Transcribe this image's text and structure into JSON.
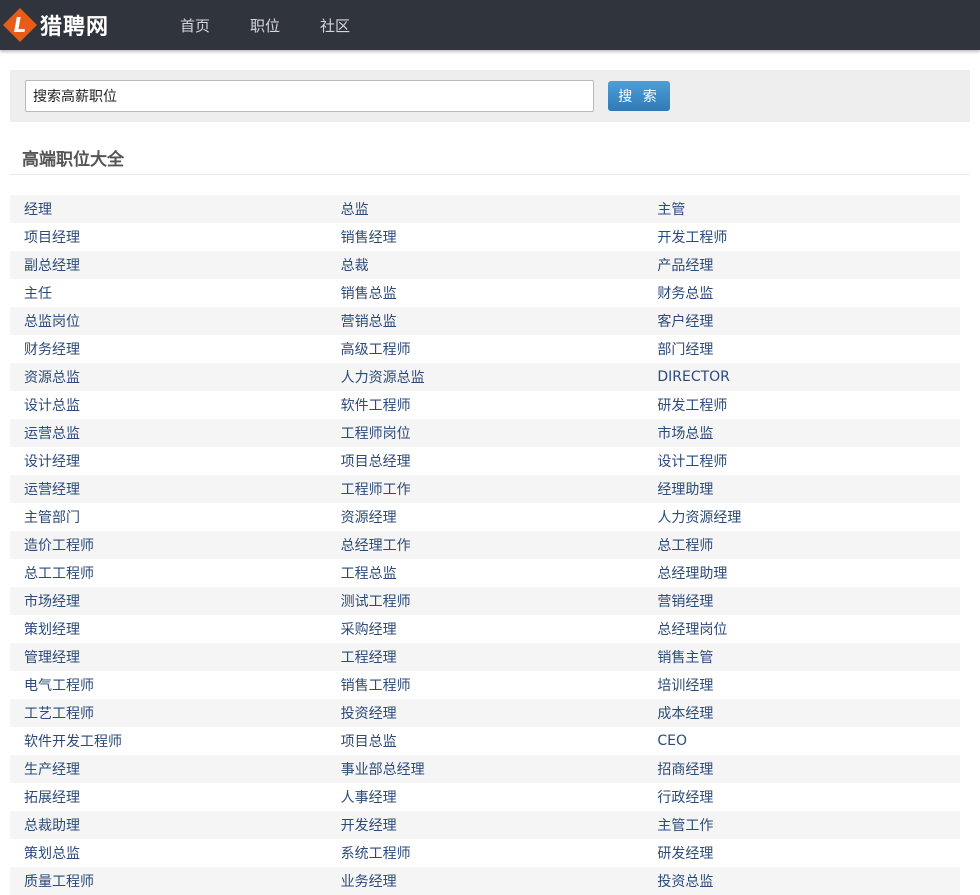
{
  "brand": {
    "logo_letter": "L",
    "name": "猎聘网",
    "accent_color": "#e85c1a"
  },
  "nav": {
    "items": [
      "首页",
      "职位",
      "社区"
    ]
  },
  "search": {
    "value": "搜索高薪职位",
    "button_label": "搜 索"
  },
  "section": {
    "title": "高端职位大全"
  },
  "jobs": {
    "rows": [
      [
        "经理",
        "总监",
        "主管"
      ],
      [
        "项目经理",
        "销售经理",
        "开发工程师"
      ],
      [
        "副总经理",
        "总裁",
        "产品经理"
      ],
      [
        "主任",
        "销售总监",
        "财务总监"
      ],
      [
        "总监岗位",
        "营销总监",
        "客户经理"
      ],
      [
        "财务经理",
        "高级工程师",
        "部门经理"
      ],
      [
        "资源总监",
        "人力资源总监",
        "DIRECTOR"
      ],
      [
        "设计总监",
        "软件工程师",
        "研发工程师"
      ],
      [
        "运营总监",
        "工程师岗位",
        "市场总监"
      ],
      [
        "设计经理",
        "项目总经理",
        "设计工程师"
      ],
      [
        "运营经理",
        "工程师工作",
        "经理助理"
      ],
      [
        "主管部门",
        "资源经理",
        "人力资源经理"
      ],
      [
        "造价工程师",
        "总经理工作",
        "总工程师"
      ],
      [
        "总工工程师",
        "工程总监",
        "总经理助理"
      ],
      [
        "市场经理",
        "测试工程师",
        "营销经理"
      ],
      [
        "策划经理",
        "采购经理",
        "总经理岗位"
      ],
      [
        "管理经理",
        "工程经理",
        "销售主管"
      ],
      [
        "电气工程师",
        "销售工程师",
        "培训经理"
      ],
      [
        "工艺工程师",
        "投资经理",
        "成本经理"
      ],
      [
        "软件开发工程师",
        "项目总监",
        "CEO"
      ],
      [
        "生产经理",
        "事业部总经理",
        "招商经理"
      ],
      [
        "拓展经理",
        "人事经理",
        "行政经理"
      ],
      [
        "总裁助理",
        "开发经理",
        "主管工作"
      ],
      [
        "策划总监",
        "系统工程师",
        "研发经理"
      ],
      [
        "质量工程师",
        "业务经理",
        "投资总监"
      ]
    ]
  }
}
